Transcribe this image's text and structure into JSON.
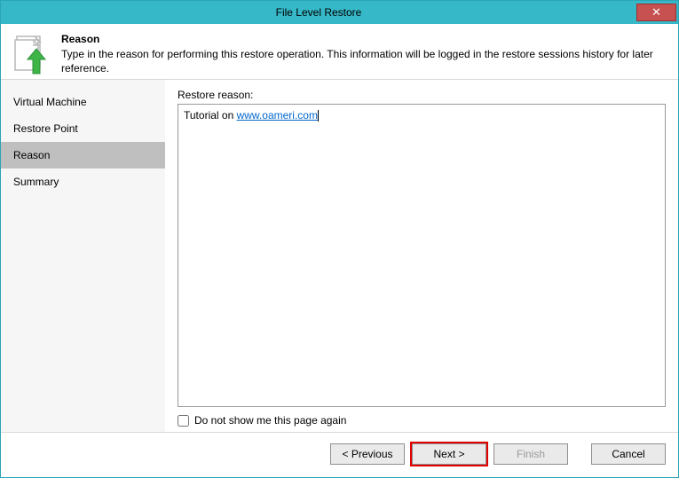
{
  "window": {
    "title": "File Level Restore",
    "close": "✕"
  },
  "header": {
    "title": "Reason",
    "description": "Type in the reason for performing this restore operation. This information will be logged in the restore sessions history for later reference."
  },
  "sidebar": {
    "items": [
      {
        "label": "Virtual Machine",
        "active": false
      },
      {
        "label": "Restore Point",
        "active": false
      },
      {
        "label": "Reason",
        "active": true
      },
      {
        "label": "Summary",
        "active": false
      }
    ]
  },
  "main": {
    "reason_label": "Restore reason:",
    "reason_text_prefix": "Tutorial on ",
    "reason_link_text": "www.oameri.com",
    "dont_show_label": "Do not show me this page again",
    "dont_show_checked": false
  },
  "footer": {
    "previous": "< Previous",
    "next": "Next >",
    "finish": "Finish",
    "cancel": "Cancel"
  }
}
